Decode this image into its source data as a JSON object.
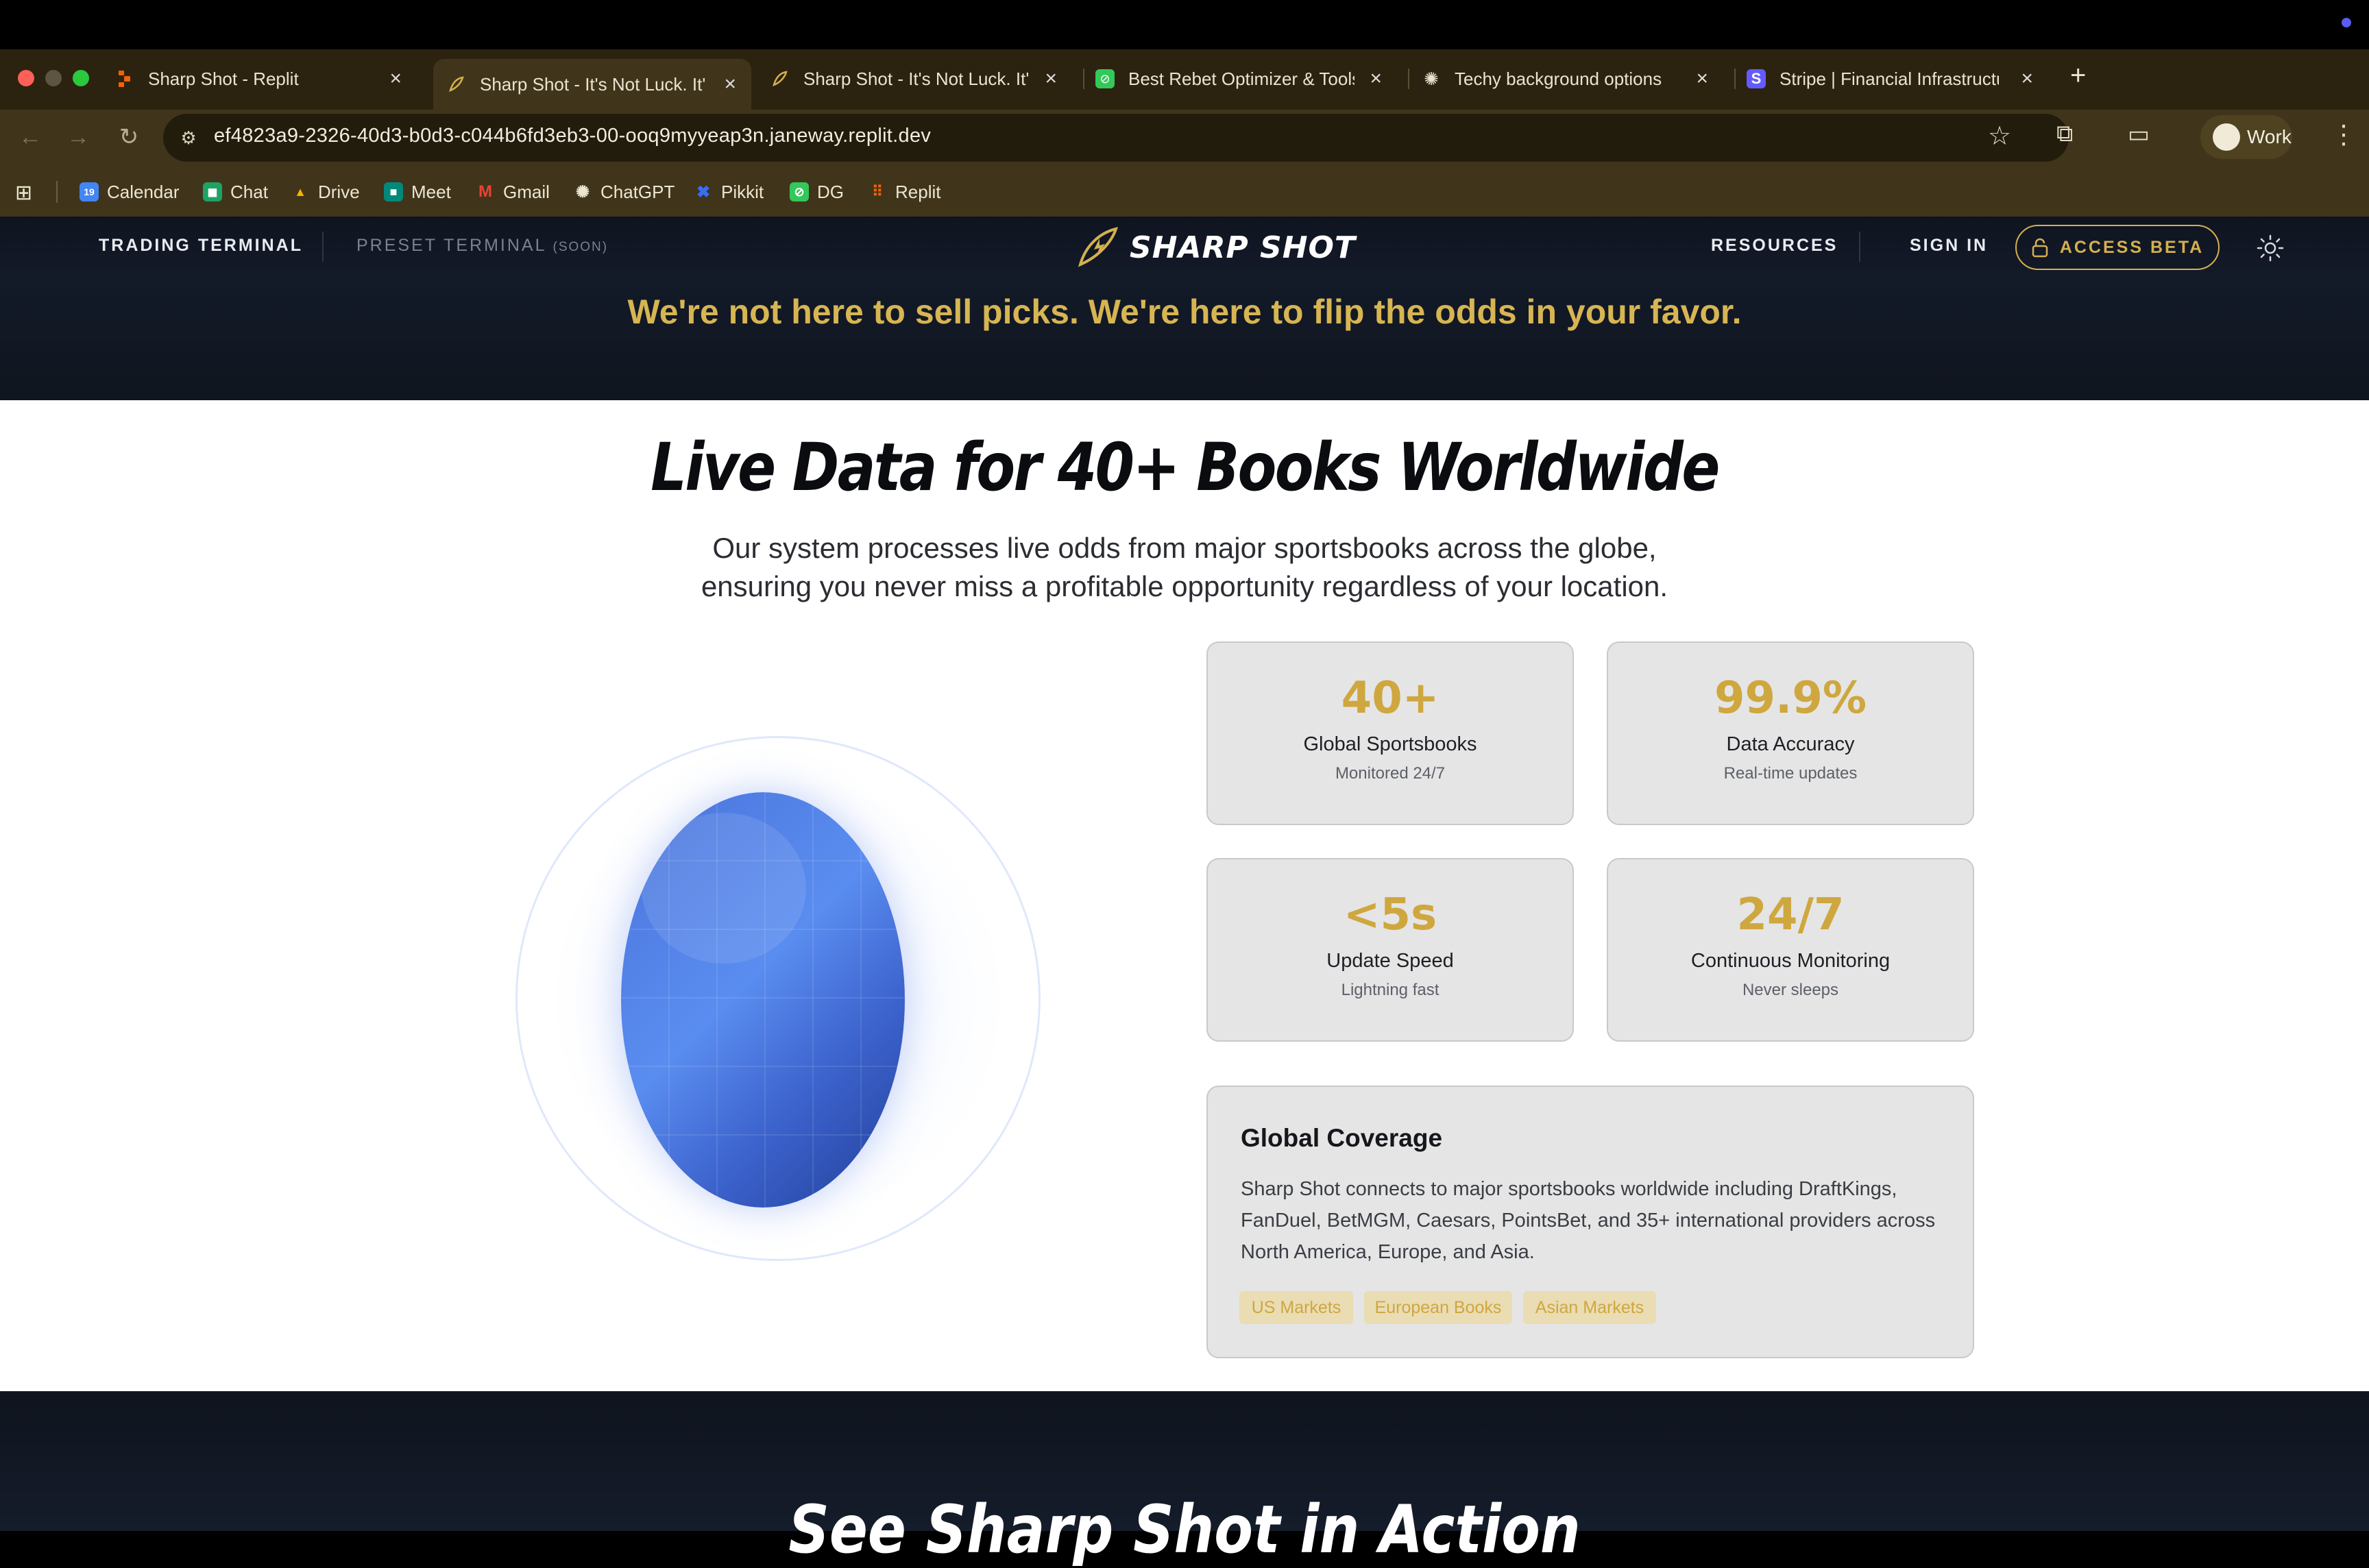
{
  "browser": {
    "tabs": [
      {
        "title": "Sharp Shot - Replit",
        "icon": "replit-icon"
      },
      {
        "title": "Sharp Shot - It's Not Luck. It's",
        "icon": "sharpshot-icon"
      },
      {
        "title": "Sharp Shot - It's Not Luck. It's",
        "icon": "sharpshot-icon"
      },
      {
        "title": "Best Rebet Optimizer & Tools",
        "icon": "link-icon"
      },
      {
        "title": "Techy background options",
        "icon": "openai-icon"
      },
      {
        "title": "Stripe | Financial Infrastructure",
        "icon": "stripe-icon"
      }
    ],
    "new_tab_label": "+",
    "url": "ef4823a9-2326-40d3-b0d3-c044b6fd3eb3-00-ooq9myyeap3n.janeway.replit.dev",
    "profile_label": "Work",
    "bookmarks": [
      {
        "label": "Calendar",
        "color": "#4285f4",
        "glyph": "19"
      },
      {
        "label": "Chat",
        "color": "#1ea362",
        "glyph": "◼"
      },
      {
        "label": "Drive",
        "color": "#f4b400",
        "glyph": "▲"
      },
      {
        "label": "Meet",
        "color": "#00897b",
        "glyph": "■"
      },
      {
        "label": "Gmail",
        "color": "#ea4335",
        "glyph": "M"
      },
      {
        "label": "ChatGPT",
        "color": "#40351b",
        "glyph": "✺"
      },
      {
        "label": "Pikkit",
        "color": "#3b6cf6",
        "glyph": "✖"
      },
      {
        "label": "DG",
        "color": "#34c759",
        "glyph": "⊘"
      },
      {
        "label": "Replit",
        "color": "#f26207",
        "glyph": "⠿"
      }
    ]
  },
  "site": {
    "nav": {
      "trading_terminal": "TRADING TERMINAL",
      "preset_terminal": "PRESET TERMINAL",
      "preset_soon": "(SOON)",
      "brand": "SHARP SHOT",
      "resources": "RESOURCES",
      "sign_in": "SIGN IN",
      "access_beta": "ACCESS BETA"
    },
    "tagline": "We're not here to sell picks. We're here to flip the odds in your favor.",
    "headline": "Live Data for 40+ Books Worldwide",
    "subtitle_line1": "Our system processes live odds from major sportsbooks across the globe,",
    "subtitle_line2": "ensuring you never miss a profitable opportunity regardless of your location.",
    "stats": [
      {
        "value": "40+",
        "label": "Global Sportsbooks",
        "note": "Monitored 24/7"
      },
      {
        "value": "99.9%",
        "label": "Data Accuracy",
        "note": "Real-time updates"
      },
      {
        "value": "<5s",
        "label": "Update Speed",
        "note": "Lightning fast"
      },
      {
        "value": "24/7",
        "label": "Continuous Monitoring",
        "note": "Never sleeps"
      }
    ],
    "coverage": {
      "title": "Global Coverage",
      "text": "Sharp Shot connects to major sportsbooks worldwide including DraftKings, FanDuel, BetMGM, Caesars, PointsBet, and 35+ international providers across North America, Europe, and Asia.",
      "chips": [
        "US Markets",
        "European Books",
        "Asian Markets"
      ]
    },
    "next_section_title": "See Sharp Shot in Action",
    "colors": {
      "accent_gold": "#d4b04f",
      "globe_blue": "#4a73db",
      "dark_bg": "#10151f"
    }
  }
}
